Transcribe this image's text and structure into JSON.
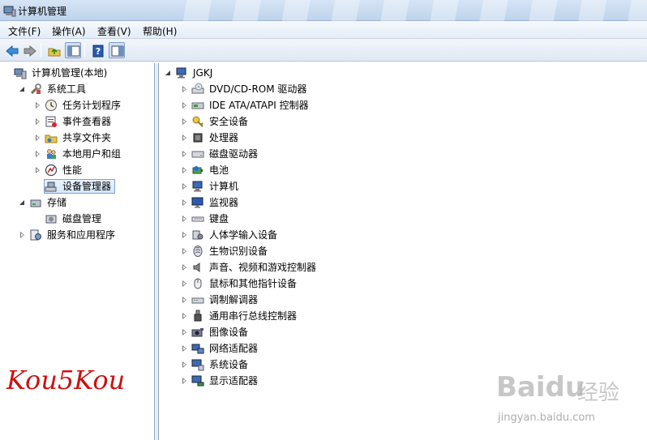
{
  "window": {
    "title": "计算机管理"
  },
  "menu": [
    {
      "label": "文件(F)"
    },
    {
      "label": "操作(A)"
    },
    {
      "label": "查看(V)"
    },
    {
      "label": "帮助(H)"
    }
  ],
  "toolbar": {
    "buttons": [
      {
        "name": "back-arrow-icon"
      },
      {
        "name": "forward-arrow-icon"
      },
      {
        "name": "up-folder-icon"
      },
      {
        "name": "show-hide-tree-icon"
      },
      {
        "name": "help-icon"
      },
      {
        "name": "properties-pane-icon"
      }
    ]
  },
  "left_tree": [
    {
      "label": "计算机管理(本地)",
      "icon": "computer-management-icon",
      "expander": "none"
    },
    {
      "label": "系统工具",
      "icon": "system-tools-icon",
      "expander": "open"
    },
    {
      "label": "任务计划程序",
      "icon": "clock-icon",
      "expander": "closed"
    },
    {
      "label": "事件查看器",
      "icon": "event-viewer-icon",
      "expander": "closed"
    },
    {
      "label": "共享文件夹",
      "icon": "shared-folder-icon",
      "expander": "closed"
    },
    {
      "label": "本地用户和组",
      "icon": "users-icon",
      "expander": "closed"
    },
    {
      "label": "性能",
      "icon": "performance-icon",
      "expander": "closed"
    },
    {
      "label": "设备管理器",
      "icon": "device-manager-icon",
      "expander": "none",
      "selected": true
    },
    {
      "label": "存储",
      "icon": "storage-icon",
      "expander": "open"
    },
    {
      "label": "磁盘管理",
      "icon": "disk-management-icon",
      "expander": "none"
    },
    {
      "label": "服务和应用程序",
      "icon": "services-icon",
      "expander": "closed"
    }
  ],
  "device_tree": {
    "root": "JGKJ",
    "items": [
      {
        "label": "DVD/CD-ROM 驱动器",
        "icon": "dvd-drive-icon"
      },
      {
        "label": "IDE ATA/ATAPI 控制器",
        "icon": "ide-controller-icon"
      },
      {
        "label": "安全设备",
        "icon": "security-key-icon"
      },
      {
        "label": "处理器",
        "icon": "processor-icon"
      },
      {
        "label": "磁盘驱动器",
        "icon": "disk-drive-icon"
      },
      {
        "label": "电池",
        "icon": "battery-icon"
      },
      {
        "label": "计算机",
        "icon": "computer-icon"
      },
      {
        "label": "监视器",
        "icon": "monitor-icon"
      },
      {
        "label": "键盘",
        "icon": "keyboard-icon"
      },
      {
        "label": "人体学输入设备",
        "icon": "hid-icon"
      },
      {
        "label": "生物识别设备",
        "icon": "fingerprint-icon"
      },
      {
        "label": "声音、视频和游戏控制器",
        "icon": "speaker-icon"
      },
      {
        "label": "鼠标和其他指针设备",
        "icon": "mouse-icon"
      },
      {
        "label": "调制解调器",
        "icon": "modem-icon"
      },
      {
        "label": "通用串行总线控制器",
        "icon": "usb-icon"
      },
      {
        "label": "图像设备",
        "icon": "camera-icon"
      },
      {
        "label": "网络适配器",
        "icon": "network-adapter-icon"
      },
      {
        "label": "系统设备",
        "icon": "system-device-icon"
      },
      {
        "label": "显示适配器",
        "icon": "display-adapter-icon"
      }
    ]
  },
  "watermark": {
    "text": "Kou5Kou"
  },
  "baidu_logo": {
    "brand": "Baidu",
    "jingyan": "经验",
    "url": "jingyan.baidu.com"
  },
  "colors": {
    "watermark_red": "#cc1111",
    "selection_border": "#7da2ce"
  }
}
